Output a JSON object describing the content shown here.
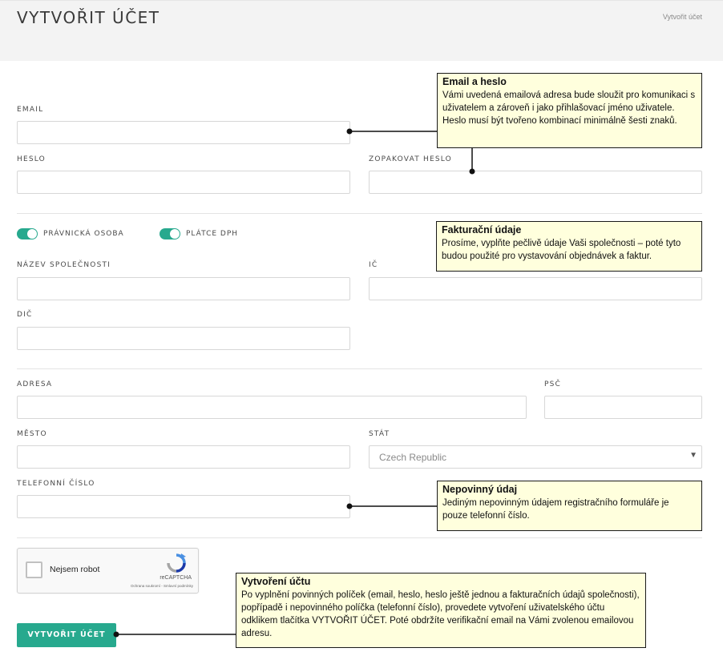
{
  "header": {
    "title": "VYTVOŘIT ÚČET",
    "breadcrumb": "Vytvořit účet"
  },
  "form": {
    "email_label": "EMAIL",
    "password_label": "HESLO",
    "password_repeat_label": "ZOPAKOVAT HESLO",
    "toggles": [
      {
        "label": "PRÁVNICKÁ OSOBA",
        "on": true
      },
      {
        "label": "PLÁTCE DPH",
        "on": true
      }
    ],
    "company_name_label": "NÁZEV SPOLEČNOSTI",
    "ic_label": "IČ",
    "dic_label": "DIČ",
    "address_label": "ADRESA",
    "zip_label": "PSČ",
    "city_label": "MĚSTO",
    "country_label": "STÁT",
    "country_value": "Czech Republic",
    "phone_label": "TELEFONNÍ ČÍSLO",
    "submit_label": "VYTVOŘIT ÚČET"
  },
  "recaptcha": {
    "label": "Nejsem robot",
    "brand": "reCAPTCHA",
    "terms": "Ochrana soukromí - Smluvní podmínky"
  },
  "callouts": {
    "email": {
      "title": "Email a heslo",
      "text": "Vámi uvedená emailová adresa bude sloužit pro komunikaci s uživatelem a zároveň i jako přihlašovací jméno uživatele. Heslo musí být tvořeno kombinací minimálně šesti znaků."
    },
    "billing": {
      "title": "Fakturační údaje",
      "text": "Prosíme, vyplňte pečlivě údaje Vaši společnosti – poté tyto budou použité pro vystavování objednávek a faktur."
    },
    "optional": {
      "title": "Nepovinný údaj",
      "text": "Jediným nepovinným údajem registračního formuláře je pouze telefonní číslo."
    },
    "create": {
      "title": "Vytvoření účtu",
      "text": "Po vyplnění povinných políček (email, heslo, heslo ještě jednou a fakturačních údajů společnosti), popřípadě i nepovinného políčka (telefonní číslo), provedete vytvoření uživatelského účtu odklikem tlačítka VYTVOŘIT ÚČET. Poté obdržíte verifikační email na Vámi zvolenou emailovou adresu."
    }
  },
  "colors": {
    "accent": "#27a98e",
    "callout_bg": "#ffffdd"
  }
}
